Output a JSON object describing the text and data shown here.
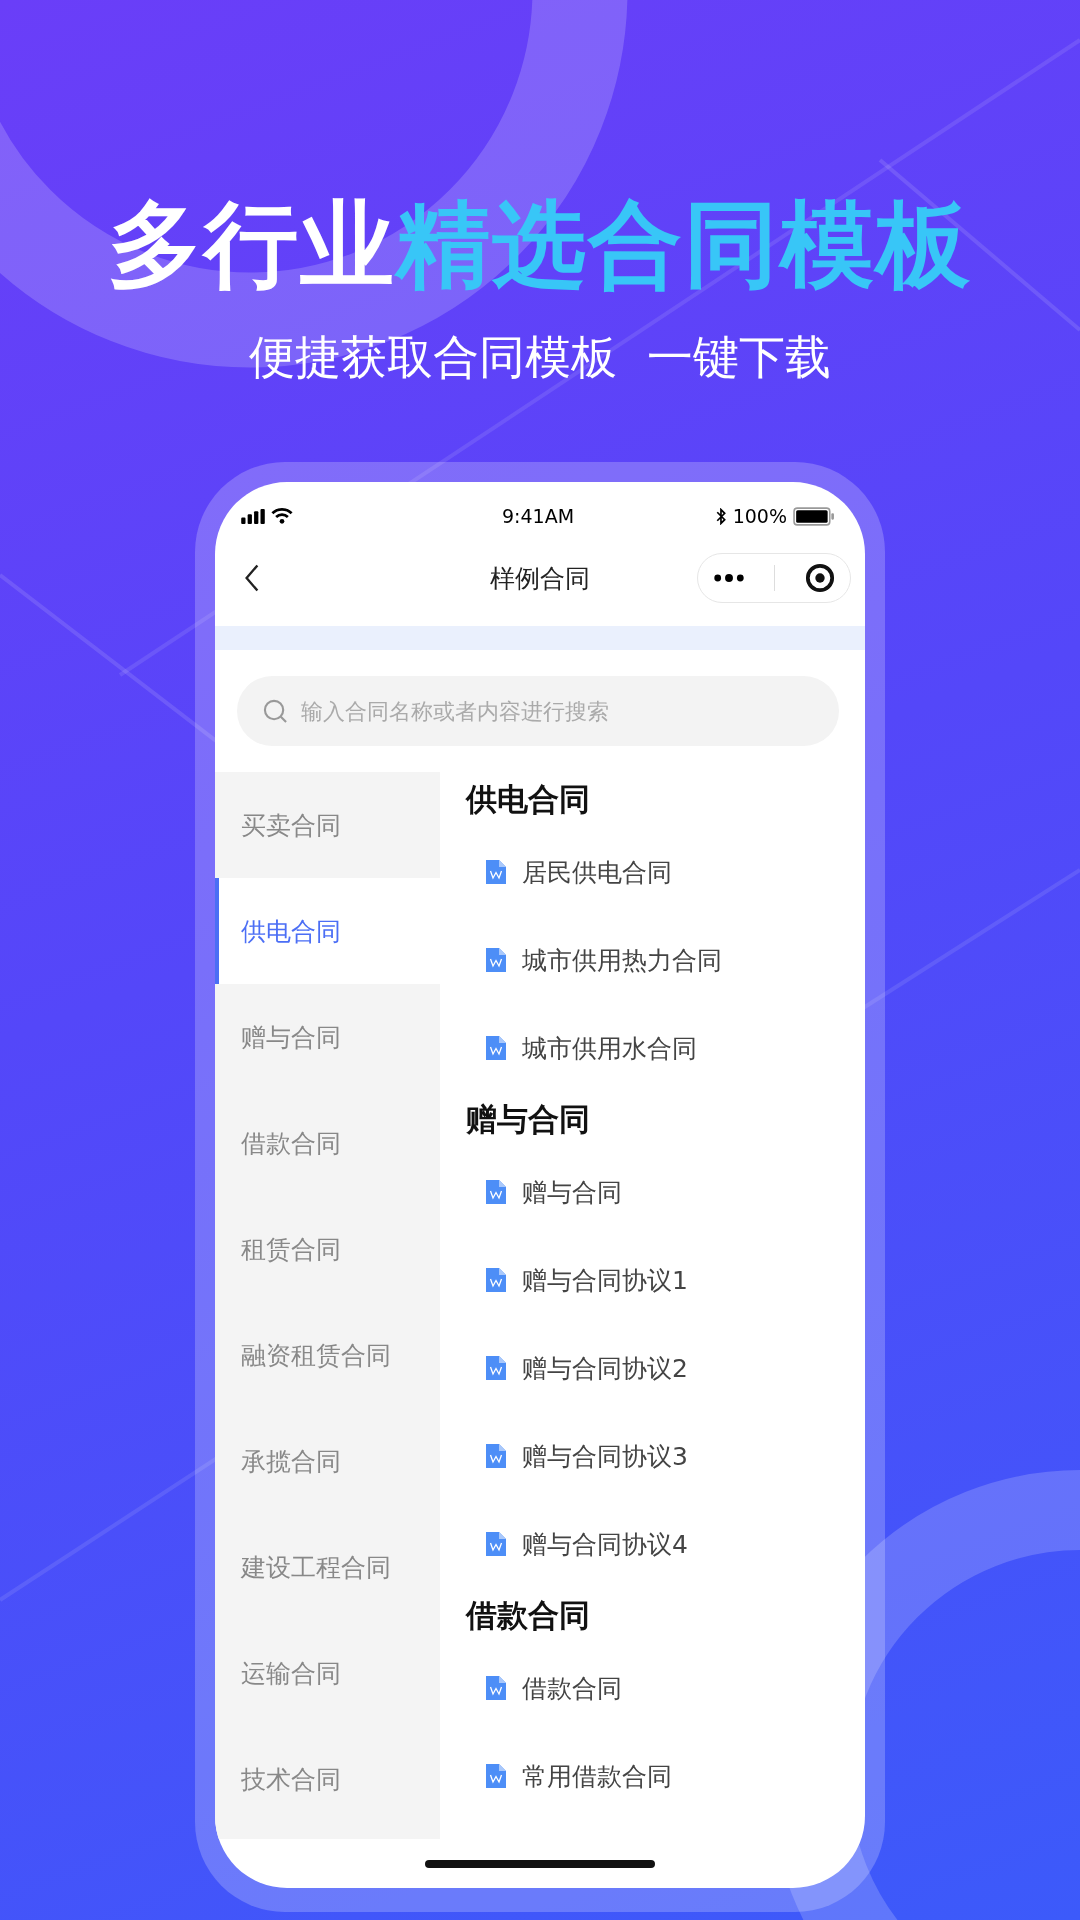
{
  "headline": {
    "plain": "多行业",
    "highlight": "精选合同模板"
  },
  "subtitle": "便捷获取合同模板  一键下载",
  "status_bar": {
    "time": "9:41AM",
    "battery": "100%"
  },
  "nav": {
    "title": "样例合同"
  },
  "search": {
    "placeholder": "输入合同名称或者内容进行搜索"
  },
  "sidebar": {
    "items": [
      {
        "label": "买卖合同",
        "selected": false
      },
      {
        "label": "供电合同",
        "selected": true
      },
      {
        "label": "赠与合同",
        "selected": false
      },
      {
        "label": "借款合同",
        "selected": false
      },
      {
        "label": "租赁合同",
        "selected": false
      },
      {
        "label": "融资租赁合同",
        "selected": false
      },
      {
        "label": "承揽合同",
        "selected": false
      },
      {
        "label": "建设工程合同",
        "selected": false
      },
      {
        "label": "运输合同",
        "selected": false
      },
      {
        "label": "技术合同",
        "selected": false
      }
    ]
  },
  "sections": [
    {
      "title": "供电合同",
      "items": [
        "居民供电合同",
        "城市供用热力合同",
        "城市供用水合同"
      ]
    },
    {
      "title": "赠与合同",
      "items": [
        "赠与合同",
        "赠与合同协议1",
        "赠与合同协议2",
        "赠与合同协议3",
        "赠与合同协议4"
      ]
    },
    {
      "title": "借款合同",
      "items": [
        "借款合同",
        "常用借款合同"
      ]
    }
  ]
}
